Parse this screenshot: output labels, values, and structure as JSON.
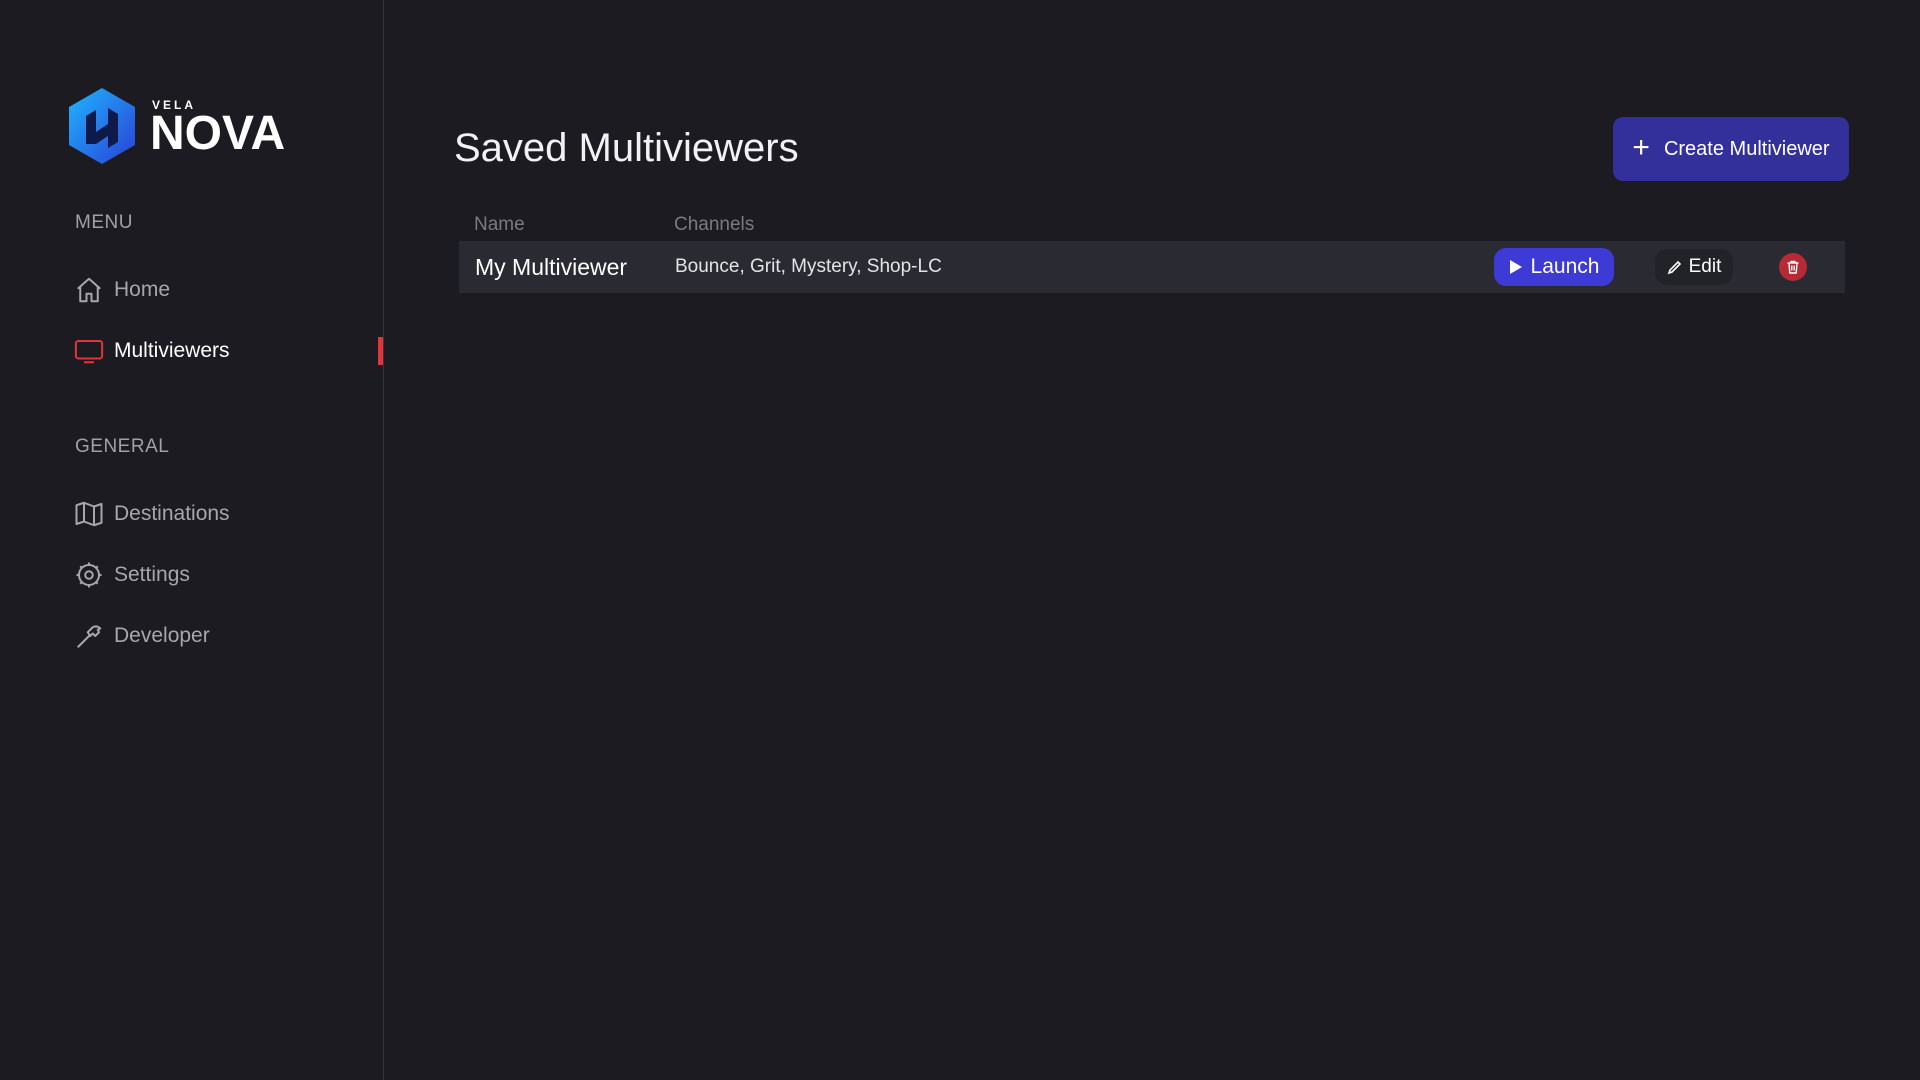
{
  "brand": {
    "sup": "VELA",
    "name": "NOVA"
  },
  "sidebar": {
    "menu_label": "MENU",
    "menu_items": [
      {
        "label": "Home",
        "icon": "home-icon"
      },
      {
        "label": "Multiviewers",
        "icon": "monitor-icon",
        "active": true
      }
    ],
    "general_label": "GENERAL",
    "general_items": [
      {
        "label": "Destinations",
        "icon": "map-icon"
      },
      {
        "label": "Settings",
        "icon": "gear-icon"
      },
      {
        "label": "Developer",
        "icon": "hammer-icon"
      }
    ]
  },
  "main": {
    "title": "Saved Multiviewers",
    "create_label": "Create Multiviewer",
    "table": {
      "columns": [
        "Name",
        "Channels"
      ],
      "rows": [
        {
          "name": "My Multiviewer",
          "channels": "Bounce, Grit, Mystery, Shop-LC",
          "launch_label": "Launch",
          "edit_label": "Edit"
        }
      ]
    }
  },
  "colors": {
    "background": "#1b1b21",
    "accent": "#3d3ad6",
    "create_button": "#34309b",
    "active_indicator": "#e0353b",
    "danger": "#b52a33"
  }
}
